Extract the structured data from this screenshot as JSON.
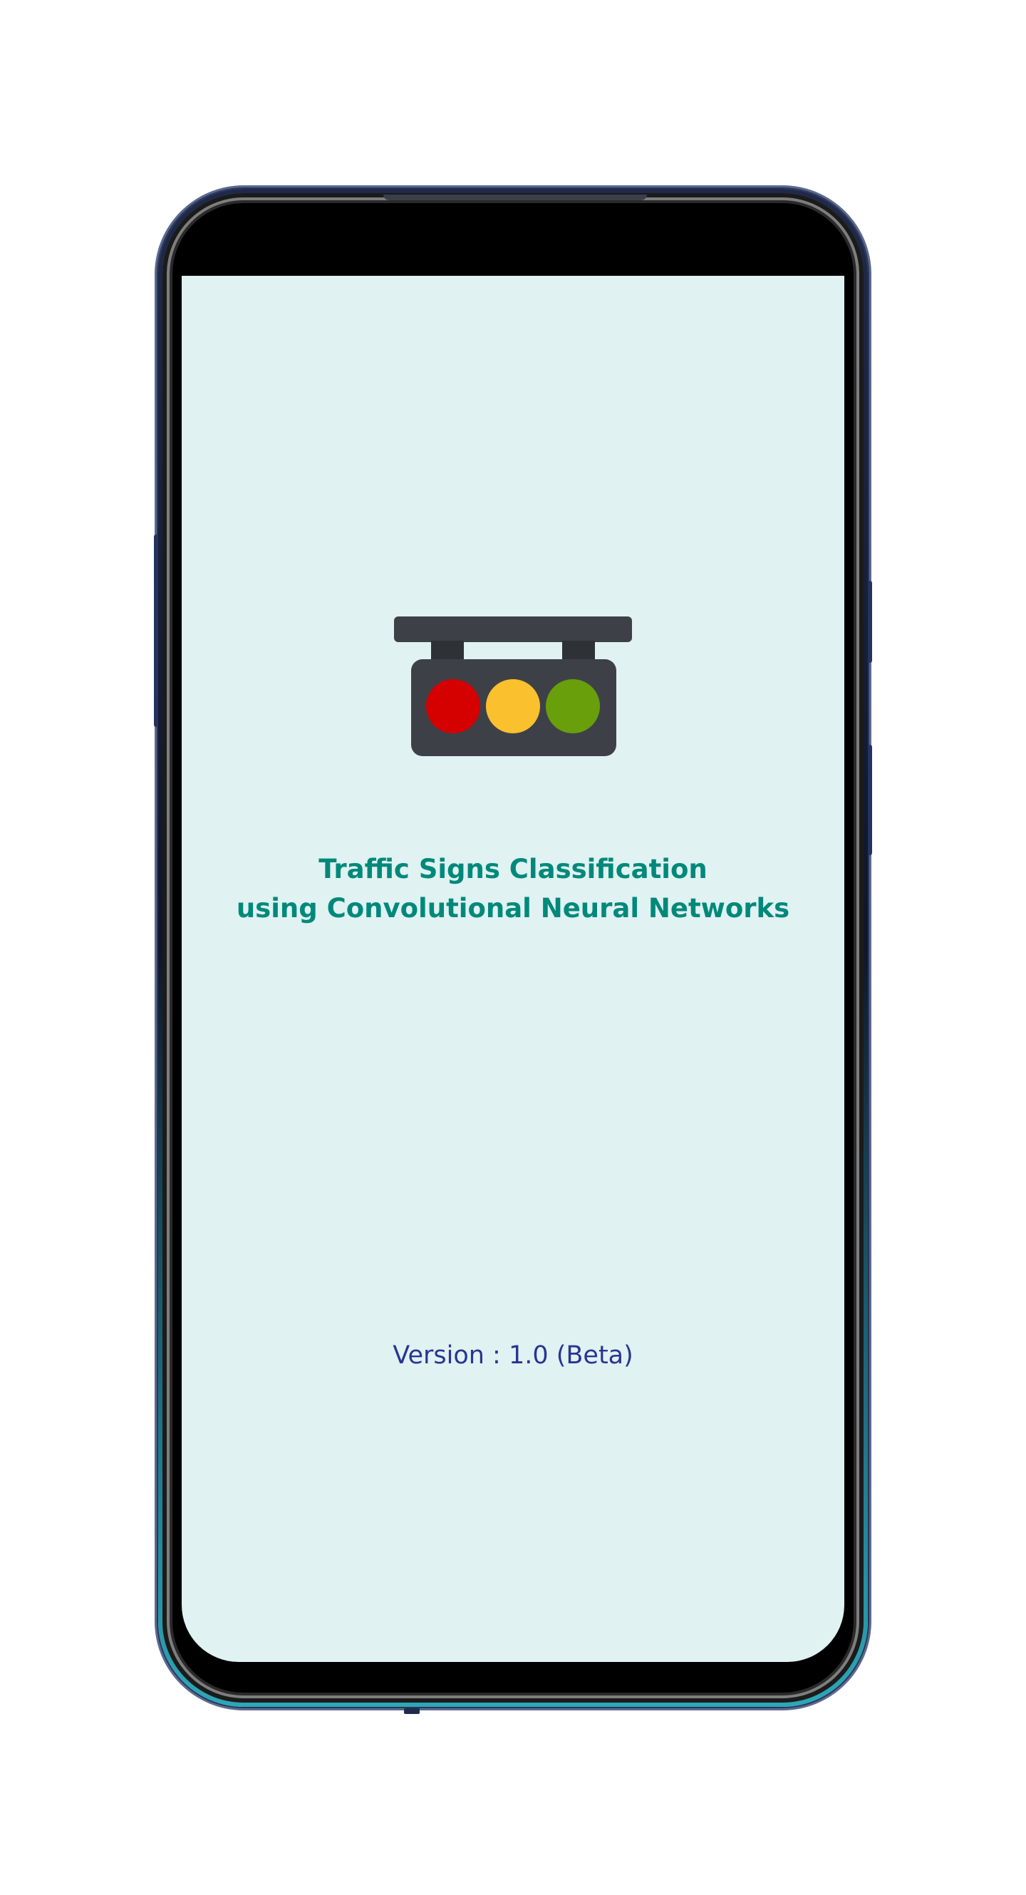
{
  "app": {
    "title_line1": "Traffic Signs Classification",
    "title_line2": "using Convolutional Neural Networks",
    "version": "Version : 1.0 (Beta)"
  },
  "logo": {
    "icon": "traffic-light-icon",
    "colors": {
      "housing": "#3d4147",
      "red": "#d50000",
      "yellow": "#fbc02d",
      "green": "#689f0a"
    }
  },
  "theme": {
    "screen_background": "#e0f2f1",
    "title_color": "#00897b",
    "version_color": "#283593"
  }
}
